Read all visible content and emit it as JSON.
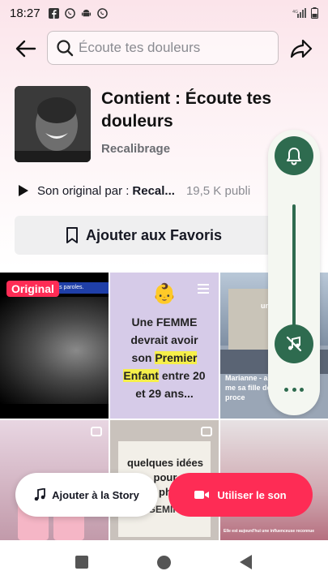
{
  "status_bar": {
    "time": "18:27",
    "icons": [
      "facebook-icon",
      "whatsapp-icon",
      "android-icon",
      "whatsapp-icon"
    ],
    "right_icons": [
      "signal-icon",
      "battery-icon"
    ]
  },
  "header": {
    "search_placeholder": "Écoute tes douleurs"
  },
  "sound": {
    "title": "Contient : Écoute tes douleurs",
    "author": "Recalibrage",
    "original_label": "Son original par :",
    "original_owner": "Recal...",
    "publications": "19,5 K publi",
    "favorite_label": "Ajouter aux Favoris"
  },
  "grid": {
    "tile1": {
      "badge": "Original",
      "banner": "ent ces paroles."
    },
    "tile2": {
      "emoji": "👶",
      "line1": "Une FEMME",
      "line2": "devrait avoir",
      "line3_a": "son ",
      "line3_hl": "Premier",
      "line4_hl": "Enfant",
      "line4_b": " entre 20",
      "line5": "et 29 ans..."
    },
    "tile3": {
      "caption_top": "une vra",
      "caption_bottom": "Marianne - abat le me sa fille de plein proce"
    },
    "tile5": {
      "line1": "quelques idées",
      "line2": "pour",
      "line3": "ph",
      "footer": "GEMINI"
    },
    "tile6": {
      "caption": "Elle est aujourd'hui une influenceuse reconnue"
    }
  },
  "actions": {
    "story_label": "Ajouter à la Story",
    "use_sound_label": "Utiliser le son"
  },
  "colors": {
    "accent": "#fe2c55",
    "panel_green": "#2e6b4f"
  }
}
